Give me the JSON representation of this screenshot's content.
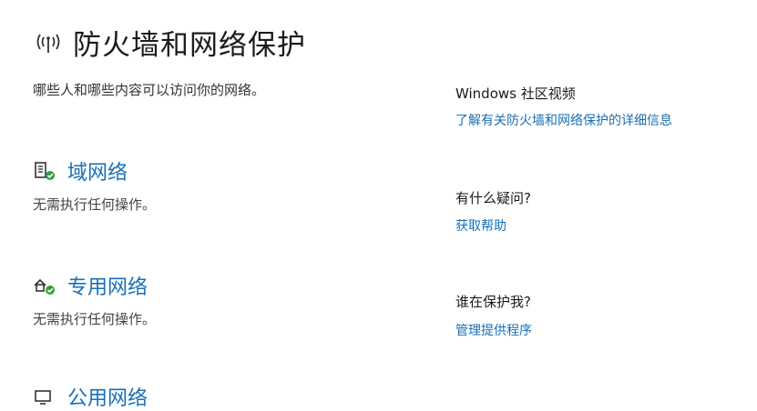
{
  "header": {
    "title": "防火墙和网络保护",
    "icon": "wifi-antenna-icon"
  },
  "subtitle": "哪些人和哪些内容可以访问你的网络。",
  "networks": [
    {
      "name": "域网络",
      "status": "无需执行任何操作。",
      "icon": "domain-network-icon"
    },
    {
      "name": "专用网络",
      "status": "无需执行任何操作。",
      "icon": "private-network-icon"
    },
    {
      "name": "公用网络",
      "icon": "public-network-icon"
    }
  ],
  "sidebar": {
    "community": {
      "heading": "Windows 社区视频",
      "link": "了解有关防火墙和网络保护的详细信息"
    },
    "questions": {
      "heading": "有什么疑问?",
      "link": "获取帮助"
    },
    "protector": {
      "heading": "谁在保护我?",
      "link": "管理提供程序"
    }
  },
  "colors": {
    "link": "#1a6fb5",
    "success_badge": "#2e9e3a"
  }
}
